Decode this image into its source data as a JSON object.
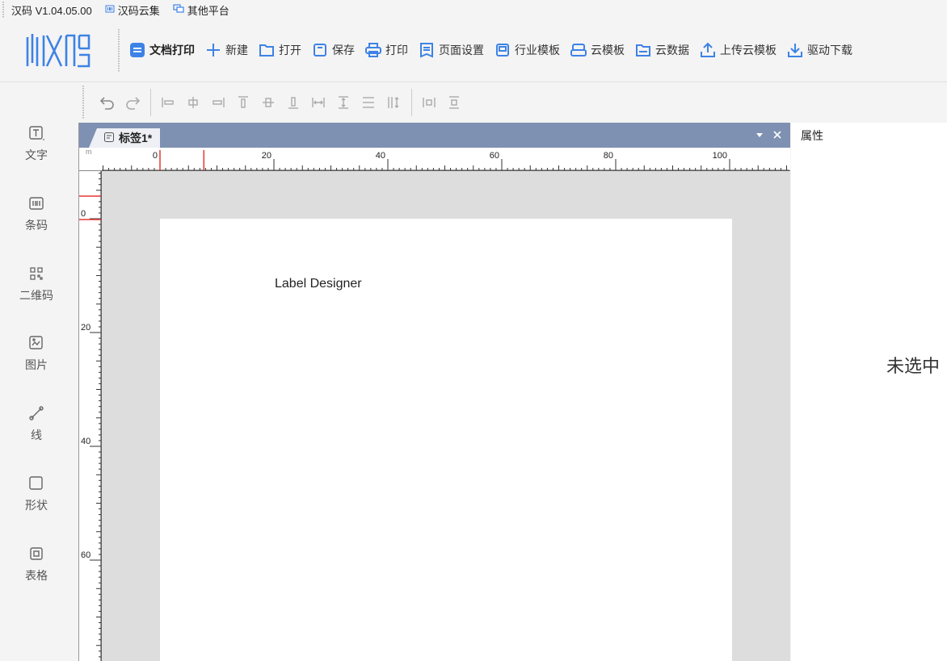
{
  "topbar": {
    "version": "汉码 V1.04.05.00",
    "cloud": "汉码云集",
    "other": "其他平台"
  },
  "toolbar": {
    "items": [
      {
        "label": "文档打印",
        "icon": "document-print-icon"
      },
      {
        "label": "新建",
        "icon": "plus-icon"
      },
      {
        "label": "打开",
        "icon": "folder-icon"
      },
      {
        "label": "保存",
        "icon": "save-icon"
      },
      {
        "label": "打印",
        "icon": "printer-icon"
      },
      {
        "label": "页面设置",
        "icon": "page-settings-icon"
      },
      {
        "label": "行业模板",
        "icon": "industry-template-icon"
      },
      {
        "label": "云模板",
        "icon": "cloud-template-icon"
      },
      {
        "label": "云数据",
        "icon": "cloud-data-icon"
      },
      {
        "label": "上传云模板",
        "icon": "upload-icon"
      },
      {
        "label": "驱动下载",
        "icon": "download-icon"
      }
    ]
  },
  "left_panel": {
    "items": [
      {
        "label": "文字",
        "icon": "text-icon"
      },
      {
        "label": "条码",
        "icon": "barcode-icon"
      },
      {
        "label": "二维码",
        "icon": "qrcode-icon"
      },
      {
        "label": "图片",
        "icon": "image-icon"
      },
      {
        "label": "线",
        "icon": "line-icon"
      },
      {
        "label": "形状",
        "icon": "shape-icon"
      },
      {
        "label": "表格",
        "icon": "table-icon"
      }
    ]
  },
  "document": {
    "tab_title": "标签1*",
    "ruler_unit": "m",
    "ruler_h_labels": [
      "0",
      "20",
      "40",
      "60",
      "80",
      "100"
    ],
    "ruler_v_labels": [
      "0",
      "20",
      "40",
      "60"
    ],
    "canvas_text": "Label Designer"
  },
  "properties": {
    "title": "属性",
    "empty": "未选中"
  },
  "colors": {
    "tab_bar": "#7f91b2",
    "accent_blue": "#3d82e6",
    "ruler_marker": "#e53935",
    "canvas_bg": "#dddddd"
  }
}
